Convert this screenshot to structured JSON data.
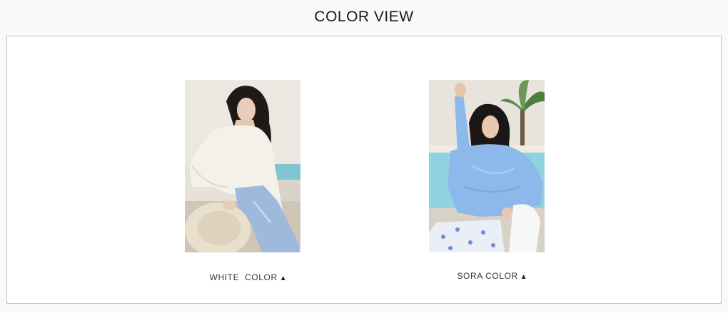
{
  "section": {
    "title": "COLOR VIEW"
  },
  "colors": [
    {
      "label": "WHITE  COLOR",
      "arrow": "▲",
      "swatch": "#f1ede6"
    },
    {
      "label": "SORA COLOR",
      "arrow": "▲",
      "swatch": "#8cb8ea"
    }
  ]
}
